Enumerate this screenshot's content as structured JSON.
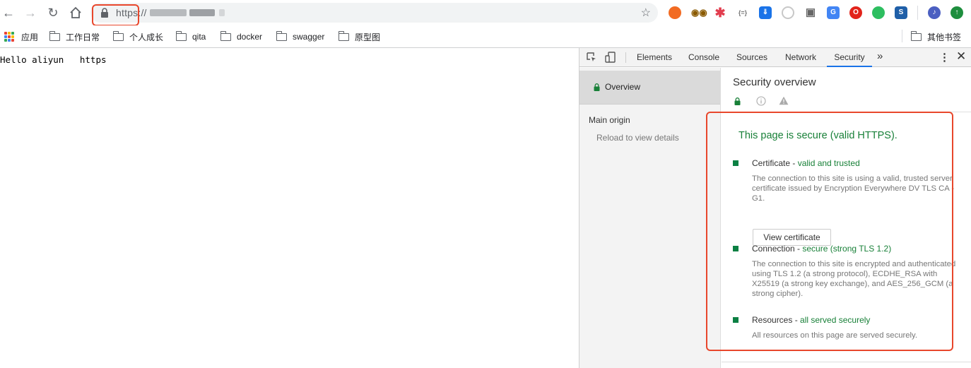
{
  "browser": {
    "url_scheme": "https://",
    "extensions": [
      "ublock-icon",
      "glasses-icon",
      "asterisk-icon",
      "json-viewer-icon",
      "pocket-icon",
      "media-icon",
      "camera-icon",
      "google-translate-icon",
      "opera-icon",
      "evernote-icon",
      "sync-icon",
      "music-icon",
      "update-icon"
    ]
  },
  "bookmarks": {
    "apps_label": "应用",
    "items": [
      "工作日常",
      "个人成长",
      "qita",
      "docker",
      "swagger",
      "原型图"
    ],
    "other": "其他书签"
  },
  "page": {
    "text": "Hello aliyun   https"
  },
  "devtools": {
    "tabs": [
      "Elements",
      "Console",
      "Sources",
      "Network",
      "Security"
    ],
    "active_tab": "Security",
    "sidebar": {
      "overview": "Overview",
      "main_origin": "Main origin",
      "reload": "Reload to view details"
    },
    "security": {
      "title": "Security overview",
      "headline": "This page is secure (valid HTTPS).",
      "certificate": {
        "label": "Certificate - ",
        "status": "valid and trusted",
        "desc": "The connection to this site is using a valid, trusted server certificate issued by Encryption Everywhere DV TLS CA - G1.",
        "button": "View certificate"
      },
      "connection": {
        "label": "Connection - ",
        "status": "secure (strong TLS 1.2)",
        "desc": "The connection to this site is encrypted and authenticated using TLS 1.2 (a strong protocol), ECDHE_RSA with X25519 (a strong key exchange), and AES_256_GCM (a strong cipher)."
      },
      "resources": {
        "label": "Resources - ",
        "status": "all served securely",
        "desc": "All resources on this page are served securely."
      }
    }
  },
  "colors": {
    "secure_green": "#188038",
    "annotation_red": "#e8472c",
    "tab_accent": "#1a73e8"
  }
}
